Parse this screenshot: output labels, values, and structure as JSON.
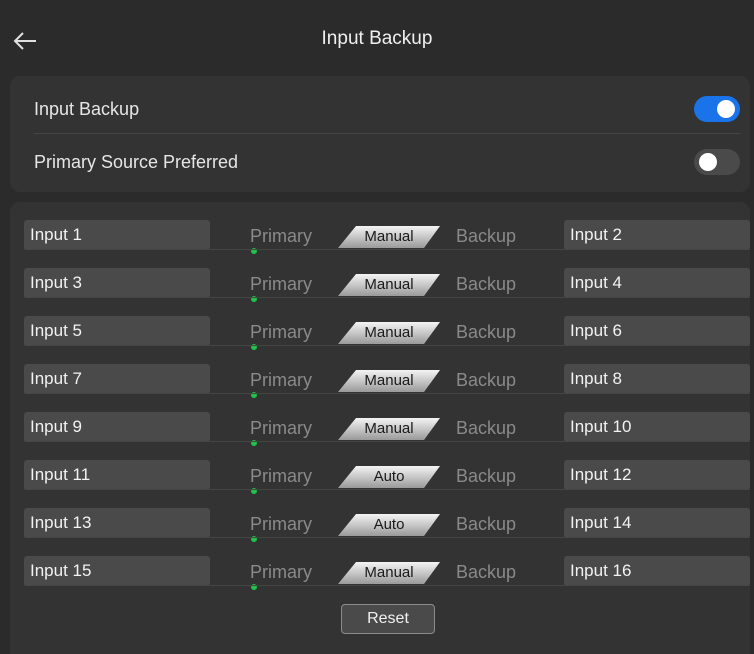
{
  "header": {
    "title": "Input Backup",
    "back_icon": "back-arrow-icon"
  },
  "settings": {
    "input_backup": {
      "label": "Input Backup",
      "enabled": true
    },
    "primary_source_preferred": {
      "label": "Primary Source Preferred",
      "enabled": false
    }
  },
  "pairs": [
    {
      "primary": "Input 1",
      "primary_label": "Primary",
      "mode": "Manual",
      "backup_label": "Backup",
      "backup": "Input 2"
    },
    {
      "primary": "Input 3",
      "primary_label": "Primary",
      "mode": "Manual",
      "backup_label": "Backup",
      "backup": "Input 4"
    },
    {
      "primary": "Input 5",
      "primary_label": "Primary",
      "mode": "Manual",
      "backup_label": "Backup",
      "backup": "Input 6"
    },
    {
      "primary": "Input 7",
      "primary_label": "Primary",
      "mode": "Manual",
      "backup_label": "Backup",
      "backup": "Input 8"
    },
    {
      "primary": "Input 9",
      "primary_label": "Primary",
      "mode": "Manual",
      "backup_label": "Backup",
      "backup": "Input 10"
    },
    {
      "primary": "Input 11",
      "primary_label": "Primary",
      "mode": "Auto",
      "backup_label": "Backup",
      "backup": "Input 12"
    },
    {
      "primary": "Input 13",
      "primary_label": "Primary",
      "mode": "Auto",
      "backup_label": "Backup",
      "backup": "Input 14"
    },
    {
      "primary": "Input 15",
      "primary_label": "Primary",
      "mode": "Manual",
      "backup_label": "Backup",
      "backup": "Input 16"
    }
  ],
  "reset_label": "Reset",
  "colors": {
    "accent": "#1a73e8",
    "active_dot": "#1ec24a",
    "background": "#2b2b2b",
    "panel": "#333333"
  }
}
